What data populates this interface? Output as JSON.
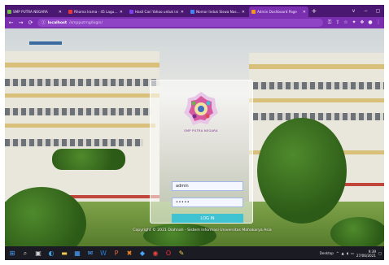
{
  "browser": {
    "tabs": [
      {
        "title": "SMP PUTRA NEGARA",
        "color": "#6fbf49",
        "active": false
      },
      {
        "title": "Rhoma Irama - 45 Lagu Terb",
        "color": "#e53935",
        "active": false
      },
      {
        "title": "Hasil Cari Yahoo untuk ini",
        "color": "#7e3ff2",
        "active": false
      },
      {
        "title": "Nomor Induk Siswa Nasional",
        "color": "#4285f4",
        "active": false
      },
      {
        "title": "Admin Dashboard Page",
        "color": "#f7941d",
        "active": true
      }
    ],
    "new_tab_glyph": "+",
    "window_controls": [
      "v",
      "−",
      "▢"
    ],
    "address": {
      "host": "localhost",
      "path": "/smpputrng/login/"
    },
    "nav_glyphs": {
      "back": "←",
      "forward": "→",
      "reload": "⟳",
      "info": "ⓘ"
    }
  },
  "login": {
    "logo_text": "SMP PUTRA NEGARA",
    "username_value": "admin",
    "password_value": "•••••",
    "button_label": "LOG IN"
  },
  "footer": {
    "copyright": "Copyright © 2021 Diahnah - Sistem Informasi Universitas Mahakarya Asia"
  },
  "taskbar": {
    "apps": [
      {
        "name": "windows-icon",
        "glyph": "⊞",
        "color": "#4aa3ff"
      },
      {
        "name": "search-icon",
        "glyph": "⌕",
        "color": "#d0d0d0"
      },
      {
        "name": "task-view-icon",
        "glyph": "▣",
        "color": "#d0d0d0"
      },
      {
        "name": "edge-icon",
        "glyph": "◐",
        "color": "#3fa0e5"
      },
      {
        "name": "file-explorer-icon",
        "glyph": "▬",
        "color": "#f2c94c"
      },
      {
        "name": "store-icon",
        "glyph": "▦",
        "color": "#4aa3ff"
      },
      {
        "name": "mail-icon",
        "glyph": "✉",
        "color": "#4aa3ff"
      },
      {
        "name": "word-icon",
        "glyph": "W",
        "color": "#2b7cd3"
      },
      {
        "name": "powerpoint-icon",
        "glyph": "P",
        "color": "#e86a3a"
      },
      {
        "name": "xampp-icon",
        "glyph": "✖",
        "color": "#f58220"
      },
      {
        "name": "photos-icon",
        "glyph": "◆",
        "color": "#4aa3ff"
      },
      {
        "name": "chrome-icon",
        "glyph": "◉",
        "color": "#e8453c"
      },
      {
        "name": "opera-icon",
        "glyph": "O",
        "color": "#ff2d3d"
      },
      {
        "name": "paint-icon",
        "glyph": "✎",
        "color": "#f2c94c"
      }
    ],
    "tray_label": "Desktop",
    "time": "9:39",
    "date": "27/06/2021"
  }
}
